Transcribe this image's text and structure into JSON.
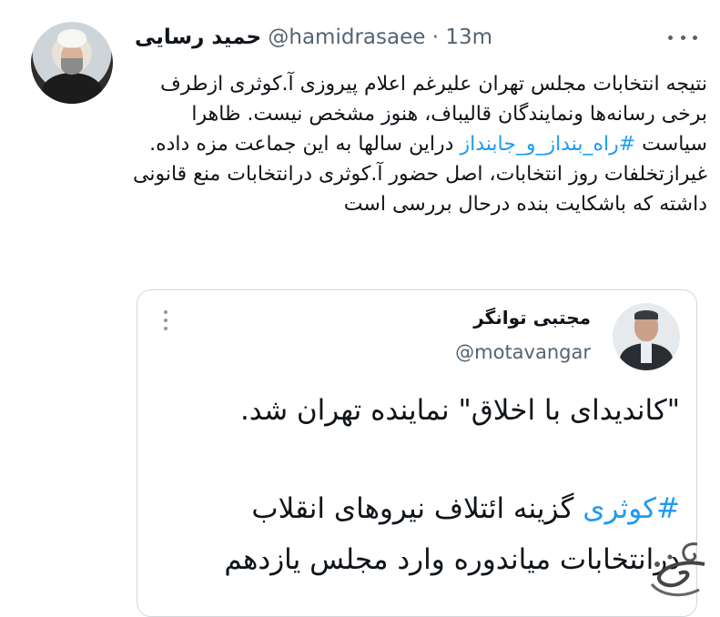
{
  "tweet": {
    "author_name": "حمید رسایی",
    "handle": "@hamidrasaee",
    "separator": "·",
    "time": "13m",
    "paragraphs": [
      {
        "pre": "نتیجه انتخابات مجلس تهران علیرغم اعلام پیروزی آ.کوثری ازطرف برخی رسانه‌ها ونمایندگان قالیباف، هنوز مشخص نیست. ظاهرا سیاست ",
        "hashtag": "#راه_بنداز_و_جابنداز",
        "post": " دراین سالها به این جماعت مزه داده."
      },
      {
        "pre": "غیرازتخلفات روز انتخابات، اصل حضور آ.کوثری درانتخابات منع قانونی داشته که باشکایت بنده درحال بررسی است",
        "hashtag": "",
        "post": ""
      }
    ],
    "more_icon": "more-horizontal-icon"
  },
  "quoted": {
    "author_name": "مجتبی توانگر",
    "handle": "@motavangar",
    "line1": "\"کاندیدای با اخلاق\" نماینده تهران شد.",
    "hashtag": "#کوثری",
    "line2_rest": " گزینه ائتلاف نیروهای انقلاب",
    "line3": "درانتخابات میاندوره  وارد مجلس یازدهم",
    "more_icon": "more-vertical-icon"
  },
  "colors": {
    "hashtag": "#1d9bf0",
    "muted": "#536471",
    "border": "#cfd9de"
  }
}
